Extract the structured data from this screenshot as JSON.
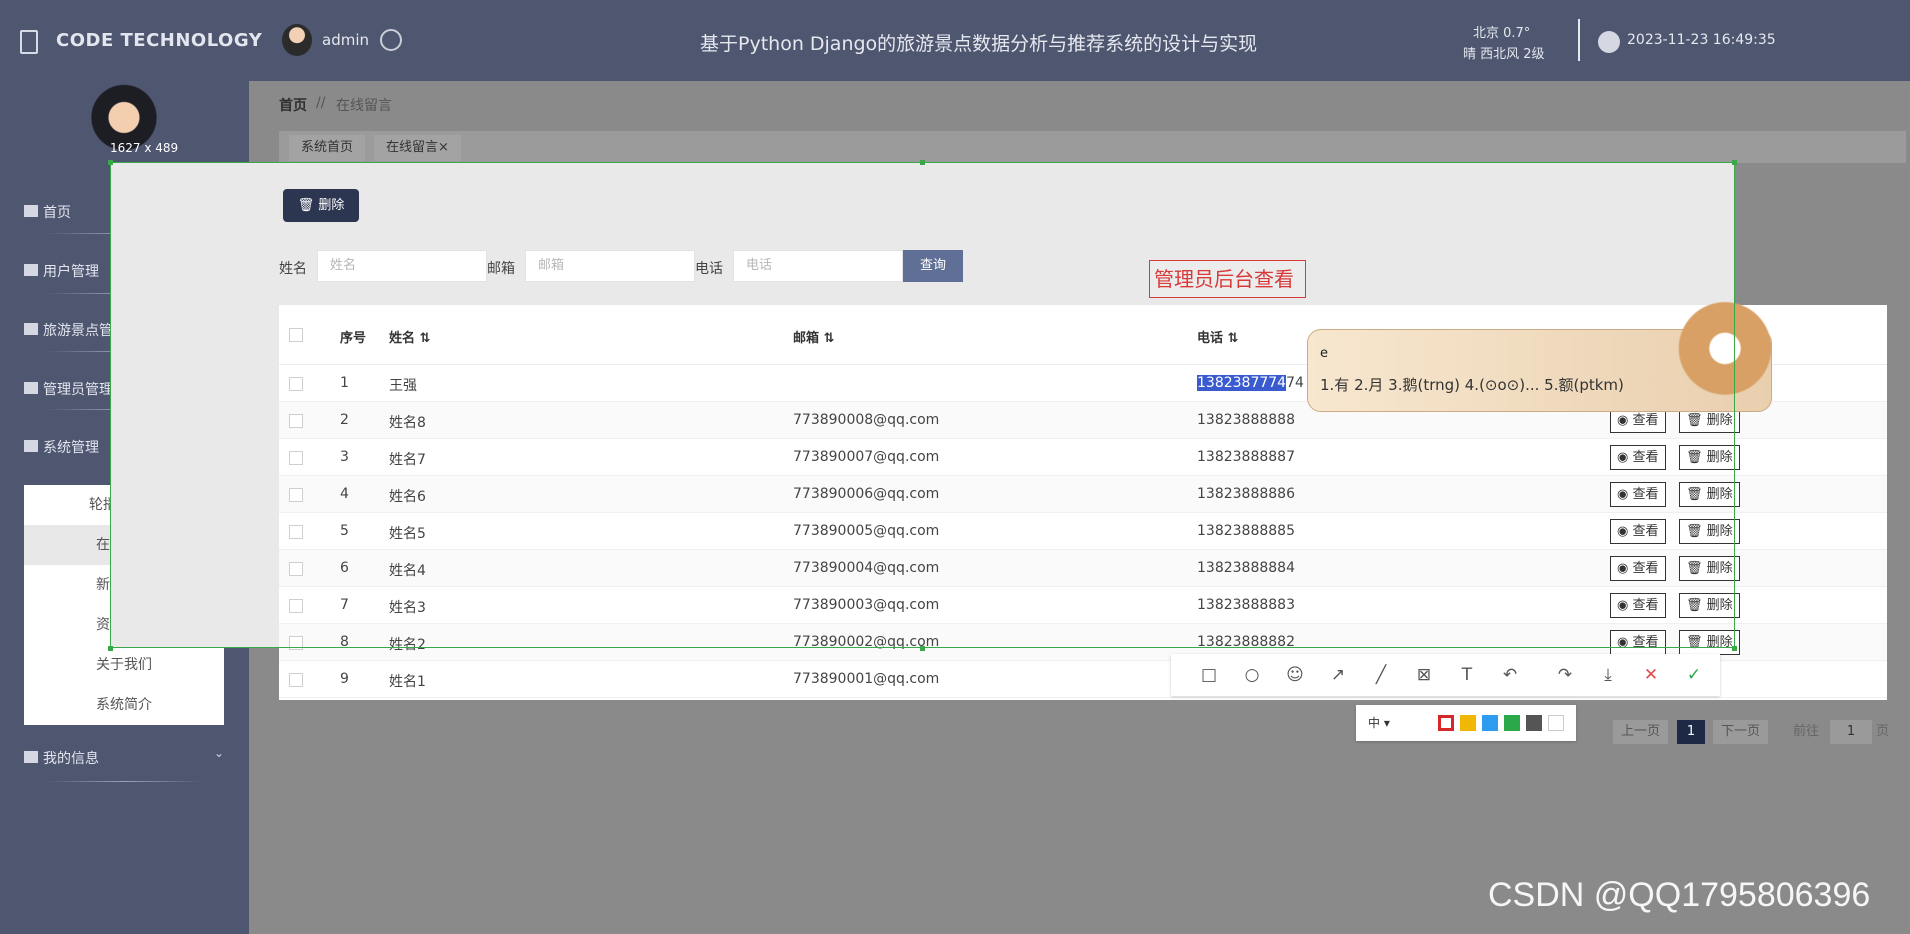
{
  "header": {
    "brand": "CODE TECHNOLOGY",
    "user": "admin",
    "title": "基于Python Django的旅游景点数据分析与推荐系统的设计与实现",
    "weather_line1": "北京  0.7°",
    "weather_line2": "晴  西北风  2级",
    "datetime": "2023-11-23 16:49:35"
  },
  "sidebar": {
    "items": [
      {
        "label": "首页"
      },
      {
        "label": "用户管理"
      },
      {
        "label": "旅游景点管理"
      },
      {
        "label": "管理员管理"
      },
      {
        "label": "系统管理"
      },
      {
        "label": "我的信息"
      }
    ],
    "submenu": [
      "轮播图管理",
      "在线留言",
      "新闻资讯",
      "资讯分类",
      "关于我们",
      "系统简介"
    ]
  },
  "breadcrumb": {
    "home": "首页",
    "sep": "//",
    "current": "在线留言"
  },
  "tabs": [
    {
      "label": "系统首页"
    },
    {
      "label": "在线留言×"
    }
  ],
  "toolbar": {
    "delete_label": "删除"
  },
  "filters": {
    "name_label": "姓名",
    "name_placeholder": "姓名",
    "email_label": "邮箱",
    "email_placeholder": "邮箱",
    "phone_label": "电话",
    "phone_placeholder": "电话",
    "query_label": "查询"
  },
  "annotation_text": "管理员后台查看",
  "table": {
    "headers": [
      "序号",
      "姓名",
      "邮箱",
      "电话"
    ],
    "view_label": "查看",
    "delete_label": "删除",
    "rows": [
      {
        "no": "1",
        "name": "王强",
        "email": "",
        "phone_sel": "1382387774",
        "phone_rest": "74"
      },
      {
        "no": "2",
        "name": "姓名8",
        "email": "773890008@qq.com",
        "phone": "13823888888"
      },
      {
        "no": "3",
        "name": "姓名7",
        "email": "773890007@qq.com",
        "phone": "13823888887"
      },
      {
        "no": "4",
        "name": "姓名6",
        "email": "773890006@qq.com",
        "phone": "13823888886"
      },
      {
        "no": "5",
        "name": "姓名5",
        "email": "773890005@qq.com",
        "phone": "13823888885"
      },
      {
        "no": "6",
        "name": "姓名4",
        "email": "773890004@qq.com",
        "phone": "13823888884"
      },
      {
        "no": "7",
        "name": "姓名3",
        "email": "773890003@qq.com",
        "phone": "13823888883"
      },
      {
        "no": "8",
        "name": "姓名2",
        "email": "773890002@qq.com",
        "phone": "13823888882"
      },
      {
        "no": "9",
        "name": "姓名1",
        "email": "773890001@qq.com",
        "phone": ""
      }
    ]
  },
  "ime": {
    "input": "e",
    "candidates": "1.有  2.月  3.鹅(trng)  4.(⊙o⊙)...  5.额(ptkm)"
  },
  "capture": {
    "size": "1627 x 489"
  },
  "palette": {
    "size_label": "中 ▾",
    "colors": [
      "#d62828",
      "#f2b705",
      "#2d9bf0",
      "#2aa84a",
      "#555555",
      "#ffffff"
    ]
  },
  "pager": {
    "prev": "上一页",
    "current": "1",
    "next": "下一页",
    "goto": "前往",
    "page_value": "1",
    "page_unit": "页"
  },
  "watermark": "CSDN @QQ1795806396"
}
